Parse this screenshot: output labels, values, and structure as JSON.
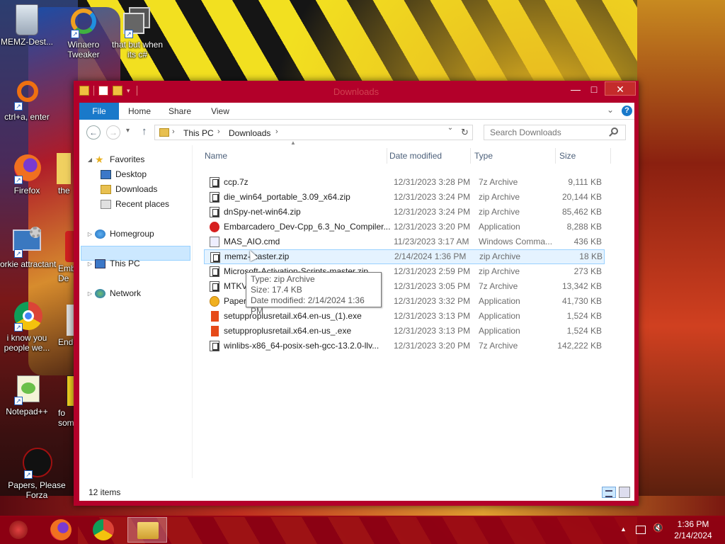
{
  "desktop": {
    "icons": [
      {
        "label": "MEMZ-Dest..."
      },
      {
        "label": "Winaero Tweaker"
      },
      {
        "label": "that but when its c#"
      },
      {
        "label": "ctrl+a, enter"
      },
      {
        "label": "Firefox"
      },
      {
        "label": "the"
      },
      {
        "label": "forkie attractant"
      },
      {
        "label": "Emb De"
      },
      {
        "label": "i know you people we..."
      },
      {
        "label": "Ende"
      },
      {
        "label": "Notepad++"
      },
      {
        "label": "fo som"
      },
      {
        "label": "Papers, Please Forza"
      }
    ]
  },
  "window": {
    "title": "Downloads",
    "close_glyph": "✕",
    "max_glyph": "□",
    "min_glyph": "—"
  },
  "ribbon": {
    "tabs": [
      "File",
      "Home",
      "Share",
      "View"
    ],
    "help": "?",
    "collapse_glyph": "⌄"
  },
  "address": {
    "back": "←",
    "forward": "→",
    "recent": "▾",
    "up": "↑",
    "crumbs": [
      "This PC",
      "Downloads"
    ],
    "sep": "›",
    "dropdown": "⌄",
    "refresh": "↻",
    "search_placeholder": "Search Downloads"
  },
  "navpane": {
    "favorites": "Favorites",
    "desktop": "Desktop",
    "downloads": "Downloads",
    "recent": "Recent places",
    "homegroup": "Homegroup",
    "thispc": "This PC",
    "network": "Network",
    "expanded": "◢",
    "collapsed": "▷"
  },
  "columns": {
    "name": "Name",
    "date": "Date modified",
    "type": "Type",
    "size": "Size"
  },
  "files": [
    {
      "name": "ccp.7z",
      "date": "12/31/2023 3:28 PM",
      "type": "7z Archive",
      "size": "9,111 KB",
      "icon": "zip"
    },
    {
      "name": "die_win64_portable_3.09_x64.zip",
      "date": "12/31/2023 3:24 PM",
      "type": "zip Archive",
      "size": "20,144 KB",
      "icon": "zip"
    },
    {
      "name": "dnSpy-net-win64.zip",
      "date": "12/31/2023 3:24 PM",
      "type": "zip Archive",
      "size": "85,462 KB",
      "icon": "zip"
    },
    {
      "name": "Embarcadero_Dev-Cpp_6.3_No_Compiler...",
      "date": "12/31/2023 3:20 PM",
      "type": "Application",
      "size": "8,288 KB",
      "icon": "emb"
    },
    {
      "name": "MAS_AIO.cmd",
      "date": "11/23/2023 3:17 AM",
      "type": "Windows Comma...",
      "size": "436 KB",
      "icon": "cmd"
    },
    {
      "name": "memz-master.zip",
      "date": "2/14/2024 1:36 PM",
      "type": "zip Archive",
      "size": "18 KB",
      "icon": "zip"
    },
    {
      "name": "Microsoft-Activation-Scripts-master.zip",
      "date": "12/31/2023 2:59 PM",
      "type": "zip Archive",
      "size": "273 KB",
      "icon": "zip"
    },
    {
      "name": "MTKV2",
      "date": "12/31/2023 3:05 PM",
      "type": "7z Archive",
      "size": "13,342 KB",
      "icon": "zip"
    },
    {
      "name": "PapersP",
      "date": "12/31/2023 3:32 PM",
      "type": "Application",
      "size": "41,730 KB",
      "icon": "papers"
    },
    {
      "name": "setupproplusretail.x64.en-us_(1).exe",
      "date": "12/31/2023 3:13 PM",
      "type": "Application",
      "size": "1,524 KB",
      "icon": "office"
    },
    {
      "name": "setupproplusretail.x64.en-us_.exe",
      "date": "12/31/2023 3:13 PM",
      "type": "Application",
      "size": "1,524 KB",
      "icon": "office"
    },
    {
      "name": "winlibs-x86_64-posix-seh-gcc-13.2.0-llv...",
      "date": "12/31/2023 3:20 PM",
      "type": "7z Archive",
      "size": "142,222 KB",
      "icon": "zip"
    }
  ],
  "tooltip": {
    "line1": "Type: zip Archive",
    "line2": "Size: 17.4 KB",
    "line3": "Date modified: 2/14/2024 1:36 PM"
  },
  "status": {
    "count": "12 items"
  },
  "taskbar": {
    "time": "1:36 PM",
    "date": "2/14/2024",
    "tray_up": "▲"
  },
  "colors": {
    "window_frame": "#b3002a",
    "accent": "#1979ca",
    "selection": "#cce8ff",
    "taskbar": "#960014"
  }
}
